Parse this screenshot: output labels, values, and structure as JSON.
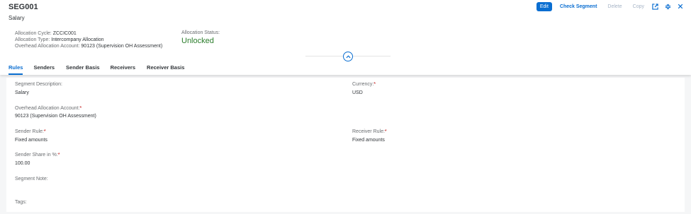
{
  "header": {
    "title": "SEG001",
    "subtitle": "Salary",
    "actions": {
      "edit": "Edit",
      "check_segment": "Check Segment",
      "delete": "Delete",
      "copy": "Copy"
    },
    "icons": [
      "share-icon",
      "exit-fullscreen-icon",
      "close-icon"
    ],
    "allocation_cycle_label": "Allocation Cycle:",
    "allocation_cycle_value": "ZCCIC001",
    "allocation_type_label": "Allocation Type:",
    "allocation_type_value": "Intercompany Allocation",
    "overhead_account_label": "Overhead Allocation Account:",
    "overhead_account_value": "90123 (Supervision OH Assessment)",
    "status_label": "Allocation Status:",
    "status_value": "Unlocked"
  },
  "tabs": [
    "Rules",
    "Senders",
    "Sender Basis",
    "Receivers",
    "Receiver Basis"
  ],
  "form": {
    "segment_description_label": "Segment Description:",
    "segment_description_value": "Salary",
    "currency_label": "Currency:",
    "currency_value": "USD",
    "overhead_account_label": "Overhead Allocation Account:",
    "overhead_account_value": "90123 (Supervision OH Assessment)",
    "sender_rule_label": "Sender Rule:",
    "sender_rule_value": "Fixed amounts",
    "receiver_rule_label": "Receiver Rule:",
    "receiver_rule_value": "Fixed amounts",
    "sender_share_label": "Sender Share in %:",
    "sender_share_value": "100.00",
    "segment_note_label": "Segment Note:",
    "tags_label": "Tags:",
    "required_marker": "*"
  },
  "colors": {
    "brand": "#0a6ed1",
    "success": "#2b7d2b",
    "required": "#bb0000"
  }
}
